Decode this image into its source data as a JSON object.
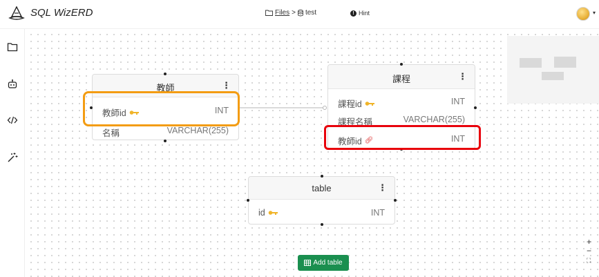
{
  "app": {
    "title": "SQL WizERD"
  },
  "breadcrumb": {
    "files_label": "Files",
    "separator": ">",
    "db_label": "test"
  },
  "hint": {
    "label": "Hint"
  },
  "tables": {
    "teacher": {
      "name": "教師",
      "columns": [
        {
          "name": "教師id",
          "type": "INT",
          "icon": "key-icon"
        },
        {
          "name": "名稱",
          "type": "VARCHAR(255)",
          "icon": ""
        }
      ]
    },
    "course": {
      "name": "課程",
      "columns": [
        {
          "name": "課程id",
          "type": "INT",
          "icon": "key-icon"
        },
        {
          "name": "課程名稱",
          "type": "VARCHAR(255)",
          "icon": ""
        },
        {
          "name": "教師id",
          "type": "INT",
          "icon": "link-icon"
        }
      ]
    },
    "table": {
      "name": "table",
      "columns": [
        {
          "name": "id",
          "type": "INT",
          "icon": "key-icon"
        }
      ]
    }
  },
  "menu_glyph": "⋮",
  "actions": {
    "add_table": "Add table"
  },
  "zoom": {
    "in": "+",
    "out": "−",
    "fit": "⛶"
  },
  "colors": {
    "highlight_orange": "#f39c12",
    "highlight_red": "#e8000b",
    "key": "#f0b429",
    "button": "#1a8f4f"
  }
}
